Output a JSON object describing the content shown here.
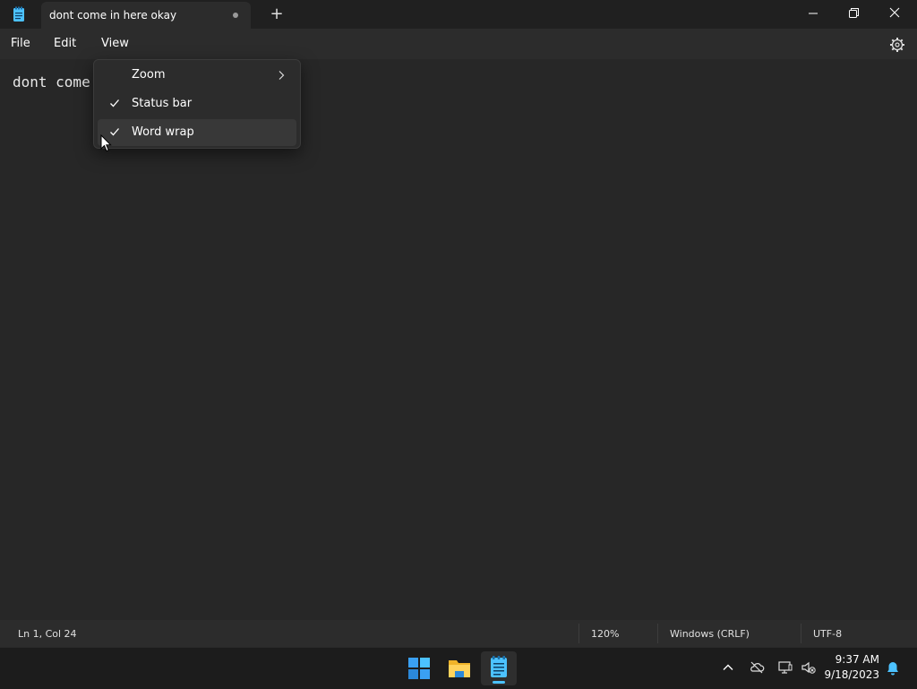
{
  "window": {
    "tab_title": "dont come in here okay",
    "new_tab_symbol": "+",
    "controls": [
      "minimize-icon",
      "restore-icon",
      "close-icon"
    ]
  },
  "menubar": {
    "file": "File",
    "edit": "Edit",
    "view": "View",
    "settings_icon": "gear-icon"
  },
  "editor": {
    "text": "dont come"
  },
  "view_menu": {
    "items": [
      {
        "label": "Zoom",
        "checked": false,
        "submenu": true
      },
      {
        "label": "Status bar",
        "checked": true,
        "submenu": false
      },
      {
        "label": "Word wrap",
        "checked": true,
        "submenu": false,
        "hovered": true
      }
    ]
  },
  "statusbar": {
    "position": "Ln 1, Col 24",
    "zoom": "120%",
    "line_endings": "Windows (CRLF)",
    "encoding": "UTF-8"
  },
  "taskbar": {
    "apps": [
      "windows-start-icon",
      "file-explorer-icon",
      "notepad-icon"
    ],
    "tray_icons": [
      "chevron-up-icon",
      "onedrive-offline-icon",
      "network-icon",
      "volume-muted-icon",
      "notification-bell-icon"
    ],
    "time": "9:37 AM",
    "date": "9/18/2023"
  },
  "colors": {
    "background": "#272727",
    "titlebar": "#202020",
    "menu": "#2c2c2c",
    "taskbar": "#1c1c1c",
    "accent": "#4cc2ff"
  }
}
